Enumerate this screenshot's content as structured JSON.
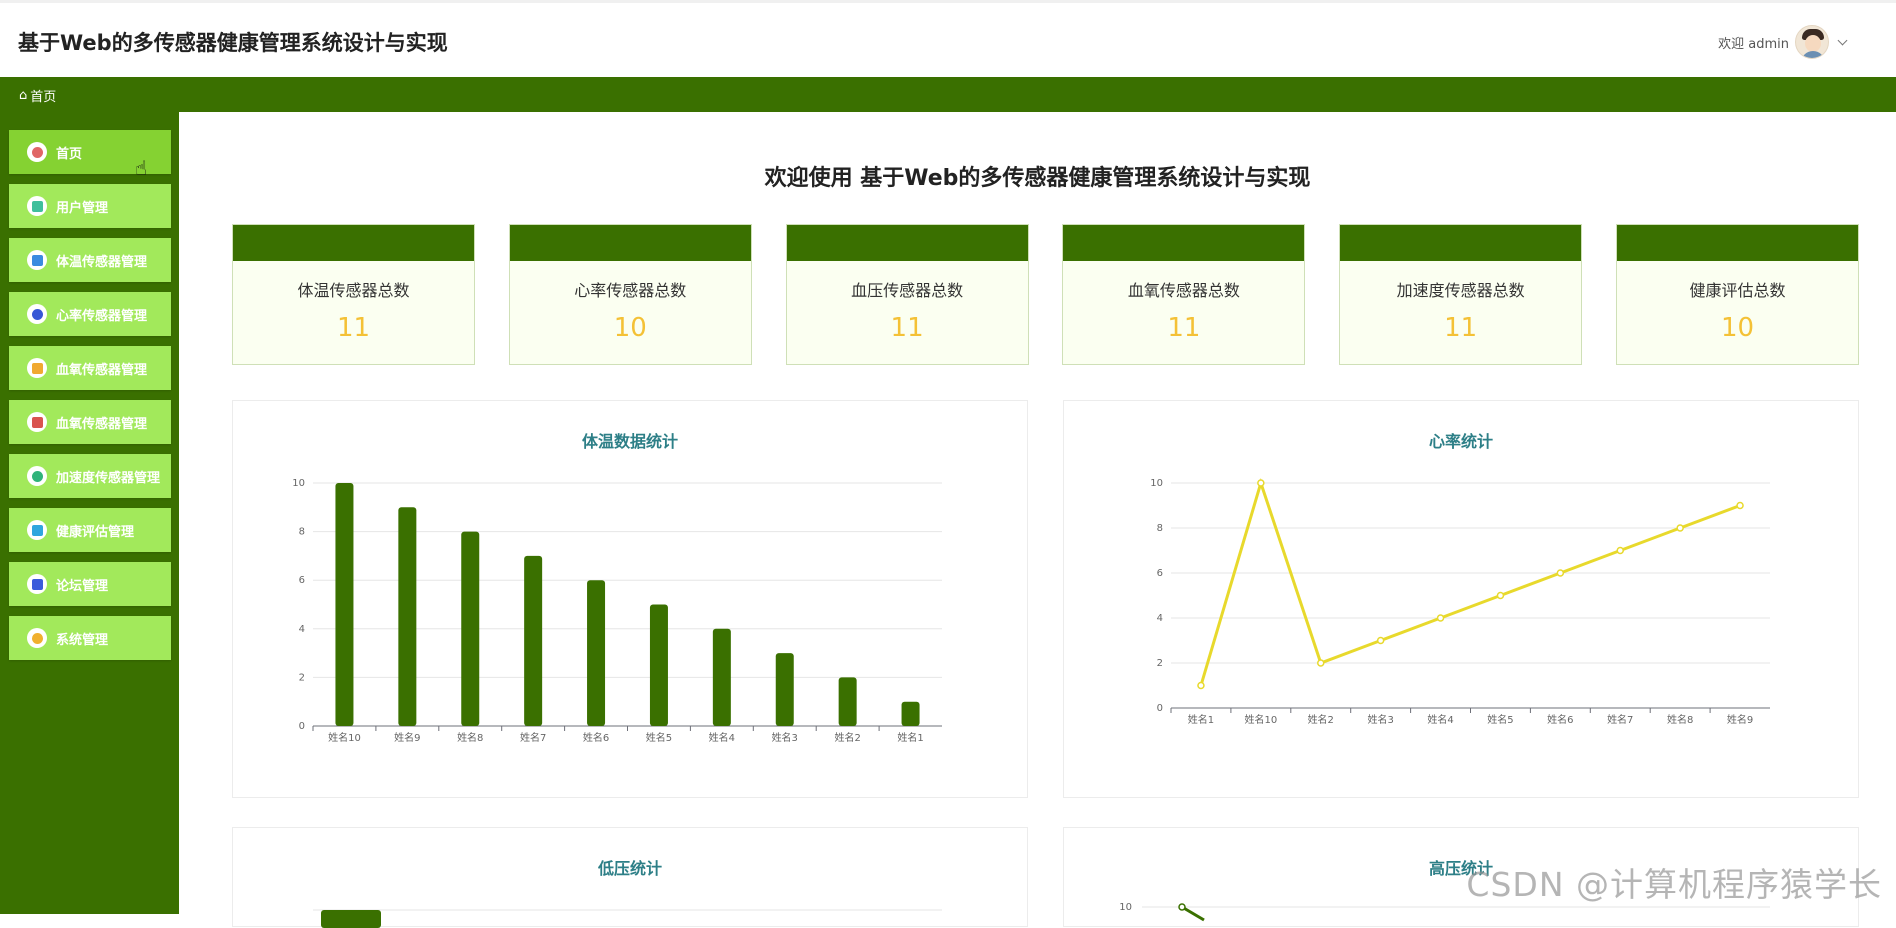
{
  "header": {
    "title": "基于Web的多传感器健康管理系统设计与实现",
    "user_label": "欢迎 admin"
  },
  "breadcrumb": {
    "home": "首页"
  },
  "sidebar": {
    "items": [
      {
        "label": "首页",
        "icon": "home-icon",
        "color": "#e06666"
      },
      {
        "label": "用户管理",
        "icon": "user-icon",
        "color": "#3fbf9c"
      },
      {
        "label": "体温传感器管理",
        "icon": "grid-icon",
        "color": "#3a8be0"
      },
      {
        "label": "心率传感器管理",
        "icon": "heart-sensor-icon",
        "color": "#3757d6"
      },
      {
        "label": "血氧传感器管理",
        "icon": "box-icon",
        "color": "#f0a930"
      },
      {
        "label": "血氧传感器管理",
        "icon": "target-icon",
        "color": "#d9534f"
      },
      {
        "label": "加速度传感器管理",
        "icon": "book-icon",
        "color": "#2fb37a"
      },
      {
        "label": "健康评估管理",
        "icon": "circle-icon",
        "color": "#2fa6de"
      },
      {
        "label": "论坛管理",
        "icon": "list-icon",
        "color": "#3b5bdb"
      },
      {
        "label": "系统管理",
        "icon": "mail-icon",
        "color": "#f0b02e"
      }
    ]
  },
  "welcome": "欢迎使用 基于Web的多传感器健康管理系统设计与实现",
  "stats": [
    {
      "label": "体温传感器总数",
      "value": "11"
    },
    {
      "label": "心率传感器总数",
      "value": "10"
    },
    {
      "label": "血压传感器总数",
      "value": "11"
    },
    {
      "label": "血氧传感器总数",
      "value": "11"
    },
    {
      "label": "加速度传感器总数",
      "value": "11"
    },
    {
      "label": "健康评估总数",
      "value": "10"
    }
  ],
  "panels": {
    "temp_title": "体温数据统计",
    "hr_title": "心率统计",
    "low_title": "低压统计",
    "high_title": "高压统计"
  },
  "chart_data": [
    {
      "type": "bar",
      "title": "体温数据统计",
      "categories": [
        "姓名10",
        "姓名9",
        "姓名8",
        "姓名7",
        "姓名6",
        "姓名5",
        "姓名4",
        "姓名3",
        "姓名2",
        "姓名1"
      ],
      "values": [
        10,
        9,
        8,
        7,
        6,
        5,
        4,
        3,
        2,
        1
      ],
      "ylim": [
        0,
        10
      ],
      "yticks": [
        0,
        2,
        4,
        6,
        8,
        10
      ],
      "color": "#3a7000"
    },
    {
      "type": "line",
      "title": "心率统计",
      "categories": [
        "姓名1",
        "姓名10",
        "姓名2",
        "姓名3",
        "姓名4",
        "姓名5",
        "姓名6",
        "姓名7",
        "姓名8",
        "姓名9"
      ],
      "values": [
        1,
        10,
        2,
        3,
        4,
        5,
        6,
        7,
        8,
        9
      ],
      "ylim": [
        0,
        10
      ],
      "yticks": [
        0,
        2,
        4,
        6,
        8,
        10
      ],
      "color": "#e8d92c"
    },
    {
      "type": "bar",
      "title": "低压统计",
      "categories": [],
      "values": []
    },
    {
      "type": "line",
      "title": "高压统计",
      "categories": [],
      "values": [
        10
      ],
      "yticks": [
        10
      ],
      "color": "#3a7000"
    }
  ],
  "watermark": "CSDN @计算机程序猿学长"
}
